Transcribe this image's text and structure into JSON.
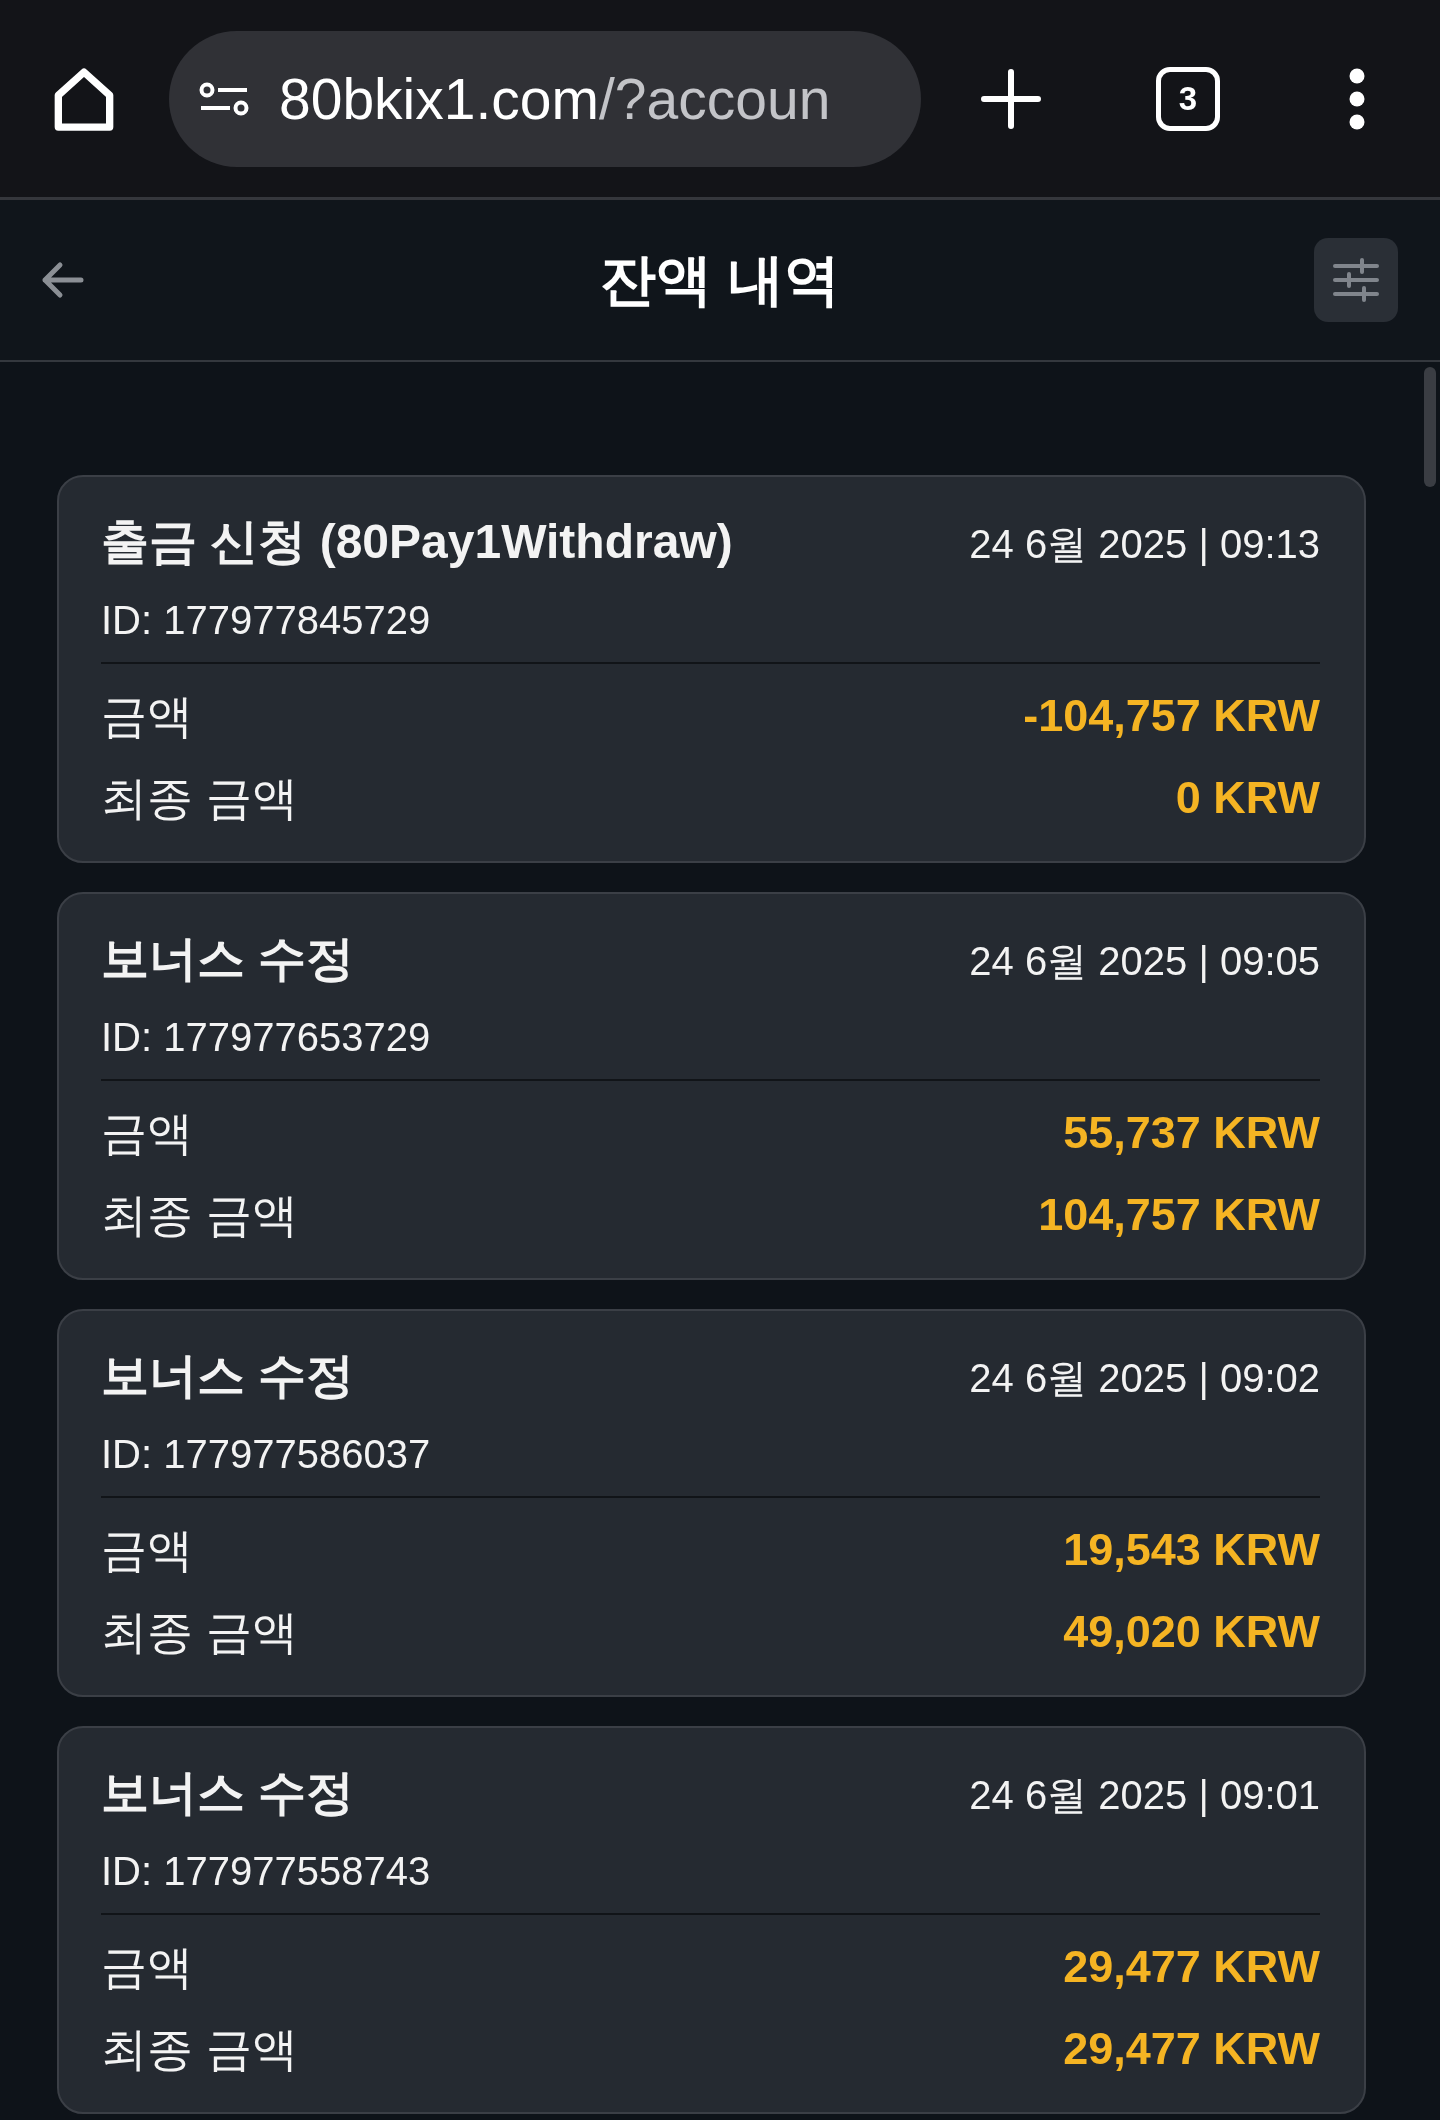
{
  "browser": {
    "url": {
      "host": "80bkix1.com",
      "path": "/?accoun"
    },
    "tab_count": "3"
  },
  "header": {
    "title": "잔액 내역"
  },
  "transactions": [
    {
      "title": "출금 신청 (80Pay1Withdraw)",
      "datetime": "24 6월 2025 | 09:13",
      "id": "ID: 177977845729",
      "rows": [
        {
          "label": "금액",
          "value": "-104,757 KRW"
        },
        {
          "label": "최종 금액",
          "value": "0 KRW"
        }
      ]
    },
    {
      "title": "보너스 수정",
      "datetime": "24 6월 2025 | 09:05",
      "id": "ID: 177977653729",
      "rows": [
        {
          "label": "금액",
          "value": "55,737 KRW"
        },
        {
          "label": "최종 금액",
          "value": "104,757 KRW"
        }
      ]
    },
    {
      "title": "보너스 수정",
      "datetime": "24 6월 2025 | 09:02",
      "id": "ID: 177977586037",
      "rows": [
        {
          "label": "금액",
          "value": "19,543 KRW"
        },
        {
          "label": "최종 금액",
          "value": "49,020 KRW"
        }
      ]
    },
    {
      "title": "보너스 수정",
      "datetime": "24 6월 2025 | 09:01",
      "id": "ID: 177977558743",
      "rows": [
        {
          "label": "금액",
          "value": "29,477 KRW"
        },
        {
          "label": "최종 금액",
          "value": "29,477 KRW"
        }
      ]
    }
  ]
}
